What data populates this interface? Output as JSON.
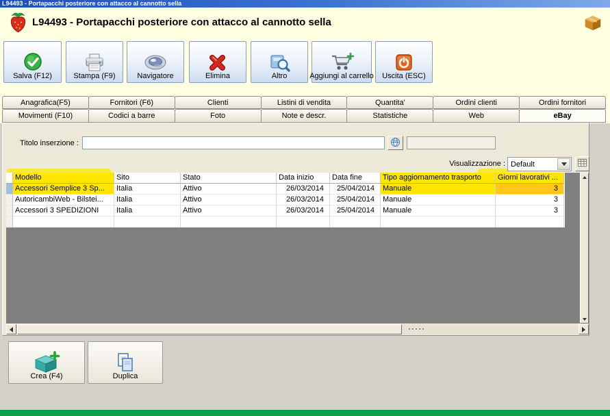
{
  "window": {
    "titlebar_text": "L94493 - Portapacchi posteriore con attacco al cannotto sella",
    "header_title": "L94493 - Portapacchi posteriore con attacco al cannotto sella"
  },
  "toolbar": {
    "buttons": [
      {
        "label": "Salva (F12)",
        "icon": "save-check-icon"
      },
      {
        "label": "Stampa (F9)",
        "icon": "printer-icon"
      },
      {
        "label": "Navigatore",
        "icon": "navigator-icon"
      },
      {
        "label": "Elimina",
        "icon": "delete-x-icon"
      },
      {
        "label": "Altro",
        "icon": "search-more-icon"
      },
      {
        "label": "Aggiungi al carrello",
        "icon": "cart-icon"
      },
      {
        "label": "Uscita (ESC)",
        "icon": "exit-power-icon"
      }
    ]
  },
  "tabs": {
    "row1": [
      {
        "label": "Anagrafica(F5)"
      },
      {
        "label": "Fornitori (F6)"
      },
      {
        "label": "Clienti"
      },
      {
        "label": "Listini di vendita"
      },
      {
        "label": "Quantita'"
      },
      {
        "label": "Ordini clienti"
      },
      {
        "label": "Ordini fornitori"
      }
    ],
    "row2": [
      {
        "label": "Movimenti (F10)"
      },
      {
        "label": "Codici a barre"
      },
      {
        "label": "Foto"
      },
      {
        "label": "Note e descr."
      },
      {
        "label": "Statistiche"
      },
      {
        "label": "Web"
      },
      {
        "label": "eBay",
        "active": true
      }
    ]
  },
  "ebay_tab": {
    "titolo_label": "Titolo inserzione :",
    "titolo_value": "",
    "secondary_value": "",
    "visualizzazione_label": "Visualizzazione :",
    "visualizzazione_value": "Default"
  },
  "table": {
    "columns": [
      "Modello",
      "Sito",
      "Stato",
      "Data inizio",
      "Data fine",
      "Tipo aggiornamento trasporto",
      "Giorni lavorativi ..."
    ],
    "rows": [
      [
        "Accessori Semplice 3 Sp...",
        "Italia",
        "Attivo",
        "26/03/2014",
        "25/04/2014",
        "Manuale",
        "3"
      ],
      [
        "AutoricambiWeb - Bilstei...",
        "Italia",
        "Attivo",
        "26/03/2014",
        "25/04/2014",
        "Manuale",
        "3"
      ],
      [
        "Accessori 3 SPEDIZIONI",
        "Italia",
        "Attivo",
        "26/03/2014",
        "25/04/2014",
        "Manuale",
        "3"
      ]
    ],
    "selected_row": 0
  },
  "footer": {
    "buttons": [
      {
        "label": "Crea (F4)",
        "icon": "create-box-icon"
      },
      {
        "label": "Duplica",
        "icon": "duplicate-pages-icon"
      }
    ]
  },
  "highlights": {
    "headers": [
      "Modello",
      "Tipo aggiornamento trasporto",
      "Giorni lavorativi ..."
    ],
    "row0_cells": [
      "Modello",
      "Tipo aggiornamento trasporto",
      "Giorni lavorativi ..."
    ],
    "label": "Visualizzazione :"
  },
  "colors": {
    "highlight_yellow": "#FFE600",
    "highlight_orange": "#FFC817",
    "header_bg": "#FFFFE1",
    "panel_bg": "#ECE9D8",
    "titlebar_blue": "#3E74D2",
    "bottom_strip_green": "#0AA14E",
    "selected_row_marker": "#9FBFE2"
  }
}
